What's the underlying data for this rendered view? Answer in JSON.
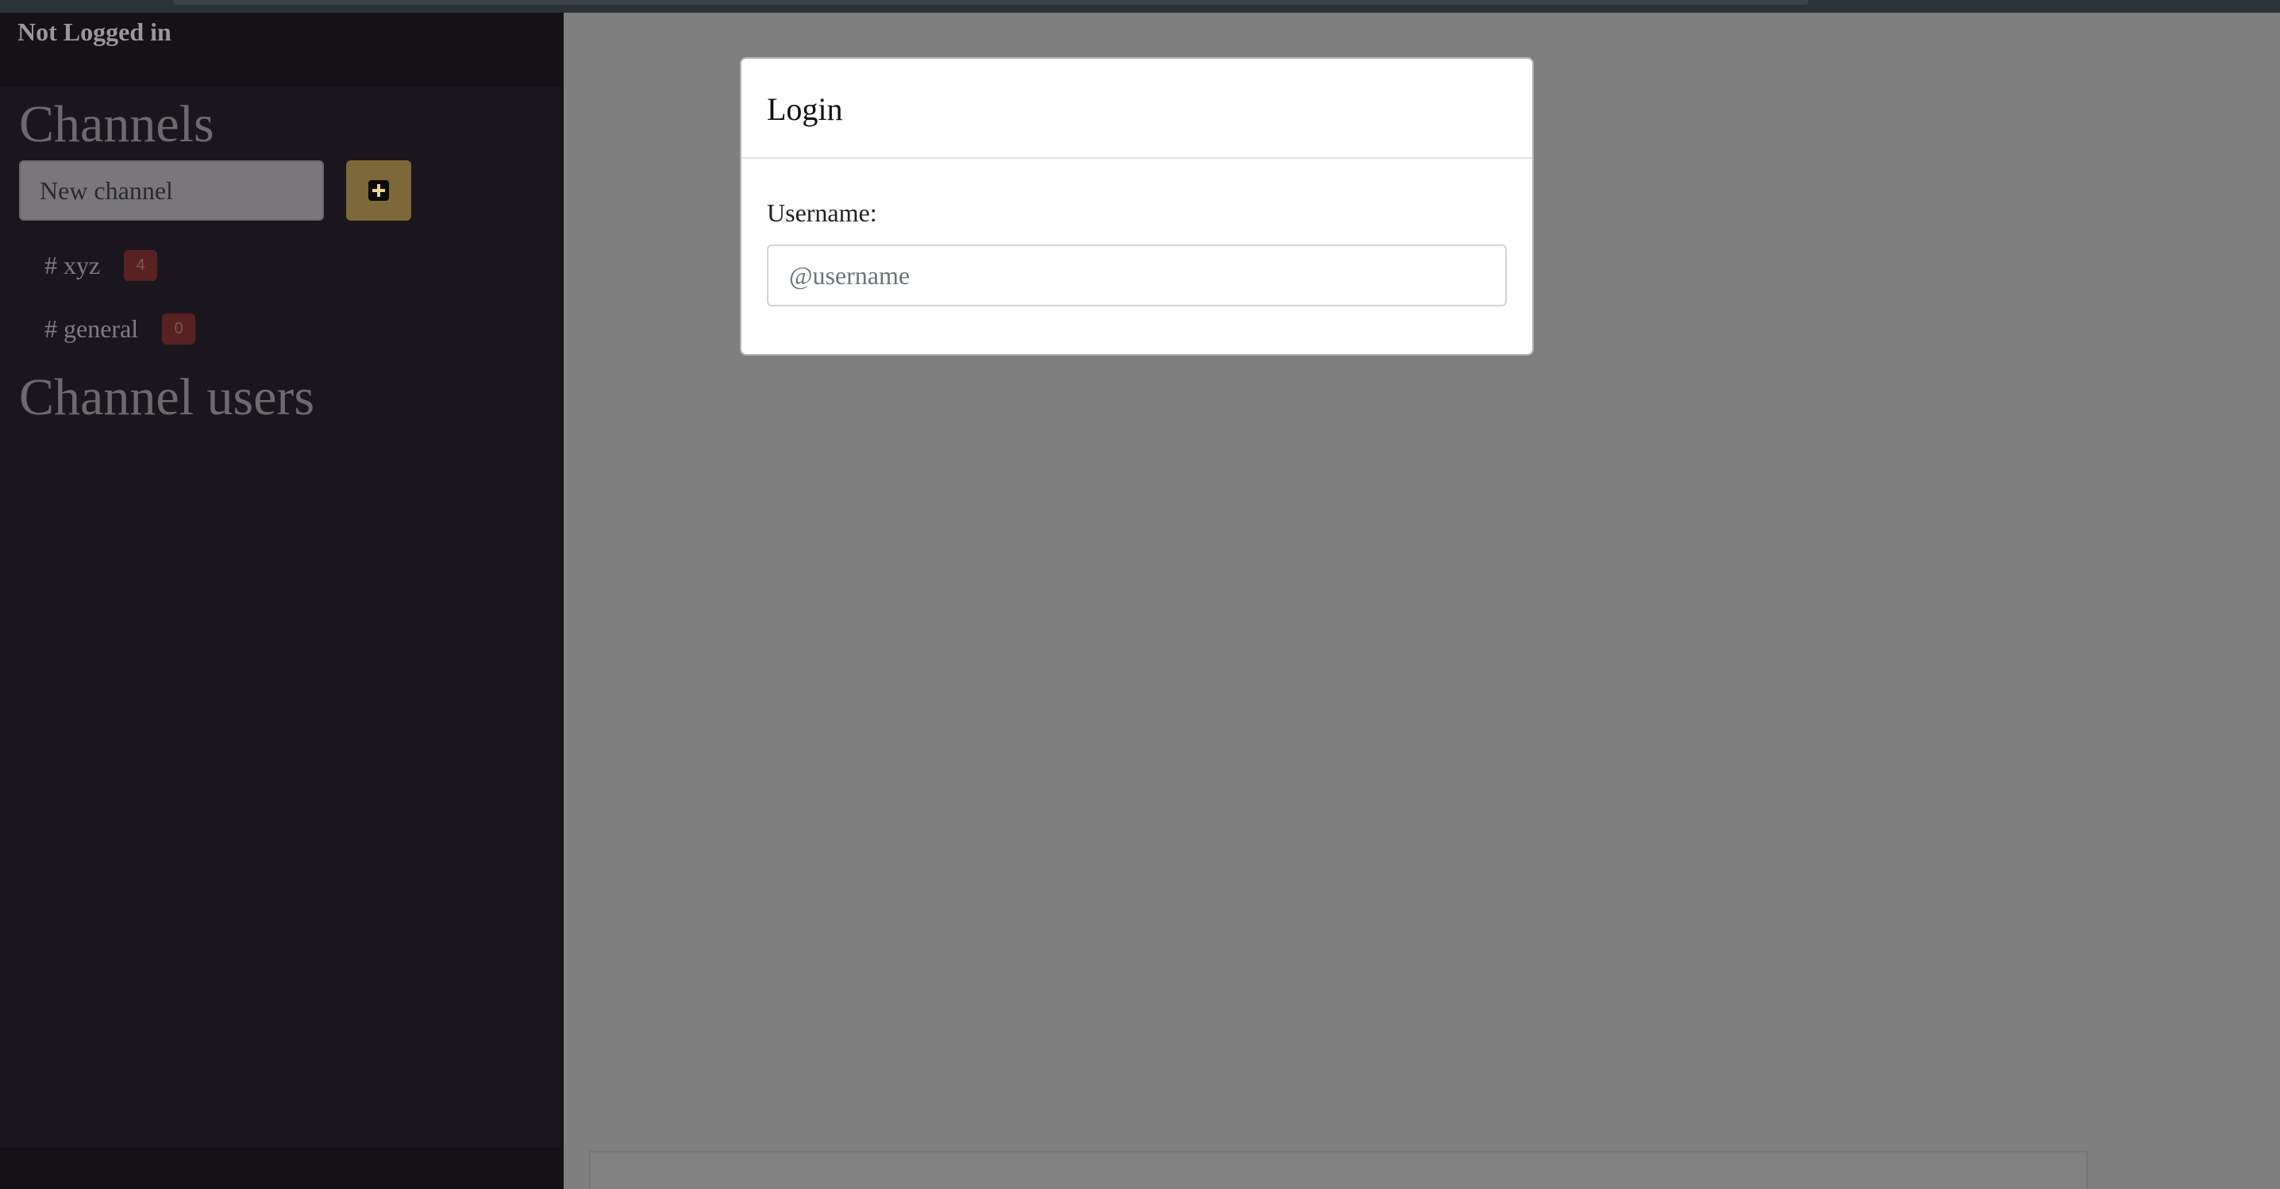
{
  "sidebar": {
    "user_status": "Not Logged in",
    "channels_title": "Channels",
    "new_channel_placeholder": "New channel",
    "add_channel_icon": "plus-square-icon",
    "channels": [
      {
        "label": "# xyz",
        "count": "4"
      },
      {
        "label": "# general",
        "count": "0"
      }
    ],
    "channel_users_title": "Channel users"
  },
  "modal": {
    "title": "Login",
    "username_label": "Username:",
    "username_placeholder": "@username",
    "username_value": ""
  },
  "colors": {
    "sidebar_bg": "#1b161d",
    "overlay": "#7f7f7f",
    "add_button": "#7c6838",
    "badge": "#592222"
  }
}
